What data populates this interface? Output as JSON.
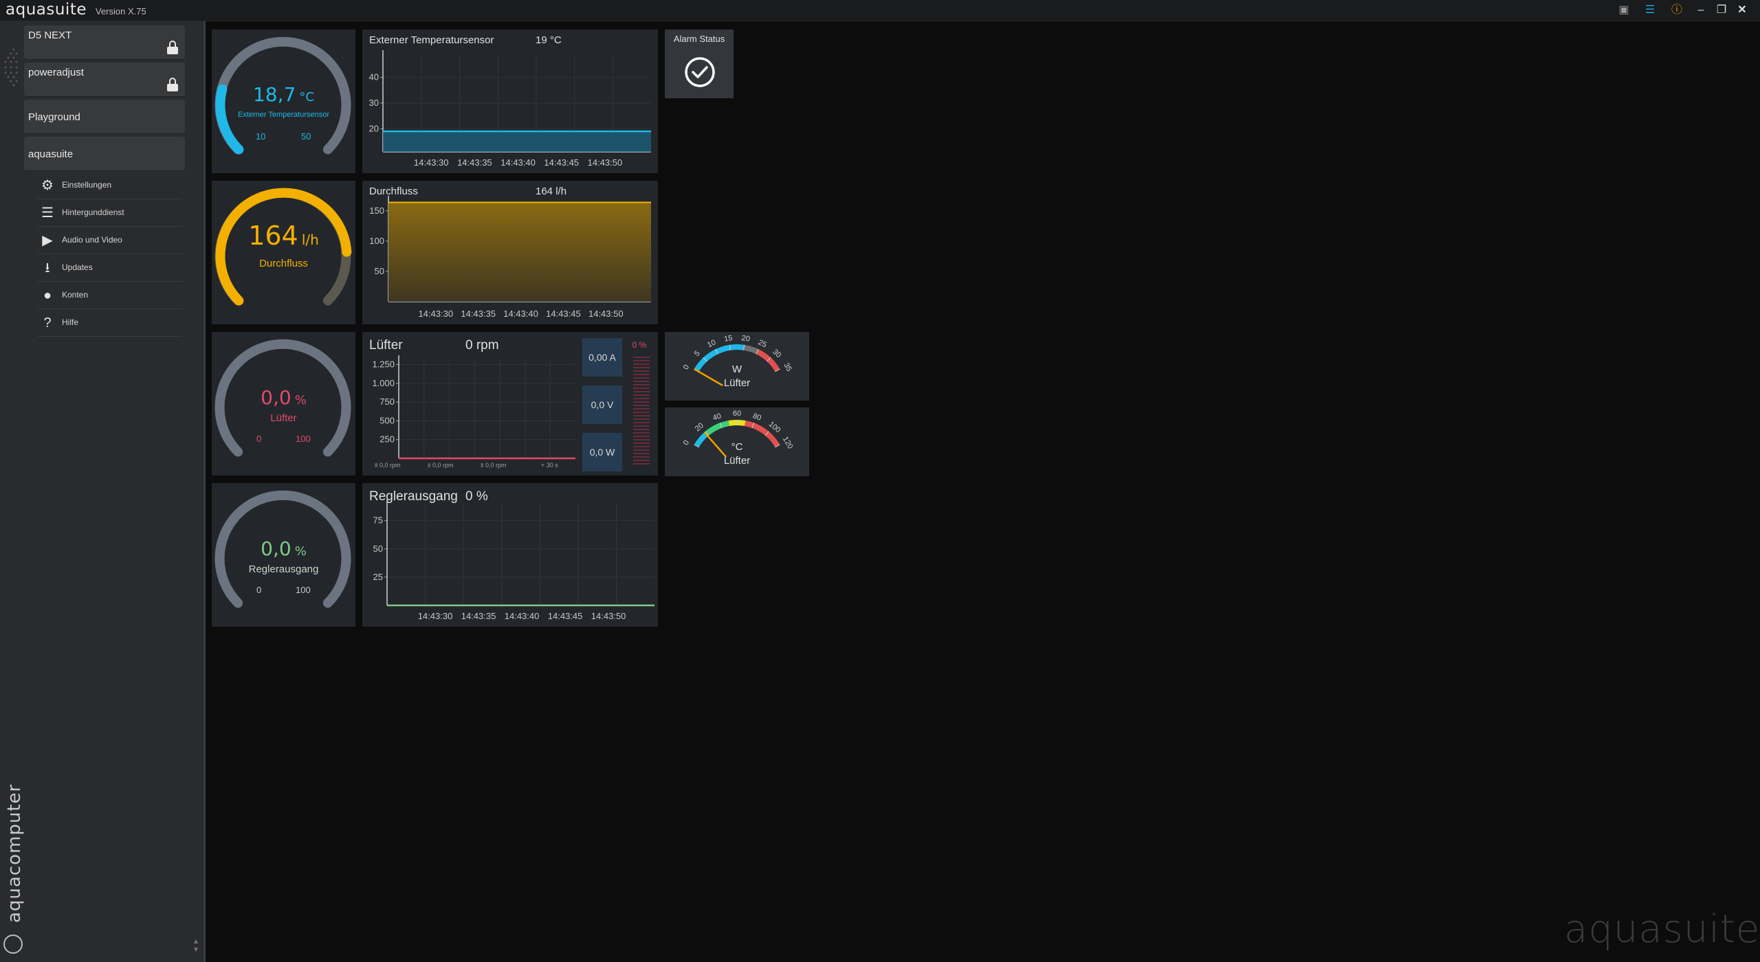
{
  "app": {
    "title": "aquasuite",
    "version": "Version X.75",
    "watermark": "aquasuite",
    "brand": "aquacomputer"
  },
  "titlebar_icons": [
    "camera-icon",
    "layers-icon",
    "info-icon",
    "minimize-icon",
    "restore-icon",
    "close-icon"
  ],
  "sidebar": {
    "devices": [
      {
        "label": "D5 NEXT",
        "locked": true
      },
      {
        "label": "poweradjust",
        "locked": true
      },
      {
        "label": "Playground",
        "locked": false
      },
      {
        "label": "aquasuite",
        "locked": false
      }
    ],
    "sub_items": [
      {
        "label": "Einstellungen",
        "icon": "gear-icon"
      },
      {
        "label": "Hintergunddienst",
        "icon": "service-list-icon"
      },
      {
        "label": "Audio und Video",
        "icon": "video-icon"
      },
      {
        "label": "Updates",
        "icon": "download-icon"
      },
      {
        "label": "Konten",
        "icon": "user-icon"
      },
      {
        "label": "Hilfe",
        "icon": "help-icon"
      }
    ]
  },
  "gauges": {
    "temp": {
      "value": "18,7",
      "unit": "°C",
      "label": "Externer Temperatursensor",
      "min": "10",
      "max": "50",
      "fraction": 0.22,
      "color": "#1fb8e8"
    },
    "flow": {
      "value": "164",
      "unit": "l/h",
      "label": "Durchfluss",
      "fraction": 0.82,
      "color": "#f4b000"
    },
    "fan": {
      "value": "0,0",
      "unit": "%",
      "label": "Lüfter",
      "min": "0",
      "max": "100",
      "fraction": 0,
      "color": "#e04a6a"
    },
    "reg": {
      "value": "0,0",
      "unit": "%",
      "label": "Reglerausgang",
      "min": "0",
      "max": "100",
      "fraction": 0,
      "color": "#7fc98a"
    }
  },
  "charts": {
    "temp": {
      "title": "Externer Temperatursensor",
      "current": "19 °C"
    },
    "flow": {
      "title": "Durchfluss",
      "current": "164 l/h"
    },
    "fan": {
      "title": "Lüfter",
      "current": "0 rpm",
      "stats": {
        "current": "0,00 A",
        "voltage": "0,0 V",
        "power": "0,0 W",
        "percent": "0 %"
      },
      "footer": [
        "x̄ 0,0 rpm",
        "x̄ 0,0 rpm",
        "x̄ 0,0 rpm",
        "+ 30 s"
      ]
    },
    "reg": {
      "title": "Reglerausgang",
      "current": "0 %"
    }
  },
  "alarm": {
    "label": "Alarm Status"
  },
  "dials": {
    "power": {
      "unit": "W",
      "label": "Lüfter",
      "ticks": [
        "0",
        "5",
        "10",
        "15",
        "20",
        "25",
        "30",
        "35"
      ],
      "value": 0
    },
    "temp": {
      "unit": "°C",
      "label": "Lüfter",
      "ticks": [
        "0",
        "20",
        "40",
        "60",
        "80",
        "100",
        "120"
      ],
      "value": 18.7
    }
  },
  "chart_data": [
    {
      "type": "line",
      "title": "Externer Temperatursensor",
      "x": [
        "14:43:30",
        "14:43:35",
        "14:43:40",
        "14:43:45",
        "14:43:50"
      ],
      "series": [
        {
          "values": [
            19,
            19,
            19,
            19,
            19
          ]
        }
      ],
      "yticks": [
        "20",
        "30",
        "40"
      ],
      "ylim": [
        11,
        49
      ],
      "color": "#1fb8e8",
      "grid": true
    },
    {
      "type": "area",
      "title": "Durchfluss",
      "x": [
        "14:43:30",
        "14:43:35",
        "14:43:40",
        "14:43:45",
        "14:43:50"
      ],
      "series": [
        {
          "values": [
            164,
            164,
            164,
            164,
            164
          ]
        }
      ],
      "yticks": [
        "50",
        "100",
        "150"
      ],
      "ylim": [
        0,
        168
      ],
      "color": "#f4b000",
      "grid": true
    },
    {
      "type": "line",
      "title": "Lüfter",
      "series": [
        {
          "values": [
            0,
            0,
            0,
            0,
            0
          ]
        }
      ],
      "yticks": [
        "250",
        "500",
        "750",
        "1.000",
        "1.250"
      ],
      "ylim": [
        0,
        1320
      ],
      "color": "#e04a6a",
      "grid": true
    },
    {
      "type": "line",
      "title": "Reglerausgang",
      "x": [
        "14:43:30",
        "14:43:35",
        "14:43:40",
        "14:43:45",
        "14:43:50"
      ],
      "series": [
        {
          "values": [
            0,
            0,
            0,
            0,
            0
          ]
        }
      ],
      "yticks": [
        "25",
        "50",
        "75"
      ],
      "ylim": [
        0,
        90
      ],
      "color": "#7fc98a",
      "grid": true
    }
  ]
}
